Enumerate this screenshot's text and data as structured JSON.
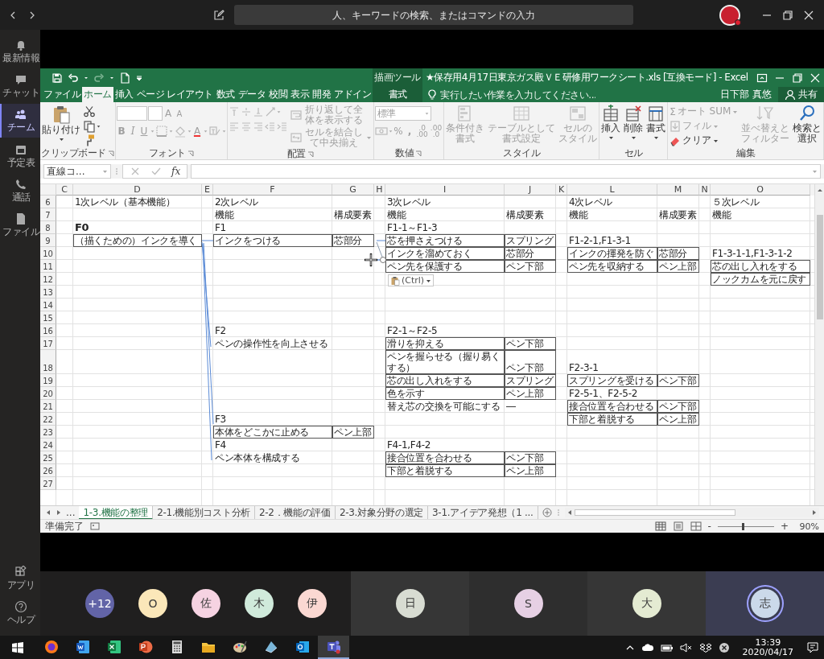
{
  "teams": {
    "search": {
      "placeholder": "人、キーワードの検索、またはコマンドの入力"
    },
    "rail": [
      {
        "label": "最新情報",
        "selected": false
      },
      {
        "label": "チャット",
        "selected": false
      },
      {
        "label": "チーム",
        "selected": true
      },
      {
        "label": "予定表",
        "selected": false
      },
      {
        "label": "通話",
        "selected": false
      },
      {
        "label": "ファイル",
        "selected": false
      }
    ],
    "rail_bottom": [
      {
        "label": "アプリ"
      },
      {
        "label": "ヘルプ"
      }
    ]
  },
  "excel": {
    "context_label": "描画ツール",
    "title": "★保存用4月17日東京ガス殿ＶＥ研修用ワークシート.xls  [互換モード] - Excel",
    "tabs": [
      {
        "label": "ファイル",
        "selected": false,
        "kind": "main"
      },
      {
        "label": "ホーム",
        "selected": true,
        "kind": "main"
      },
      {
        "label": "挿入",
        "selected": false,
        "kind": "main"
      },
      {
        "label": "ページ レイアウト",
        "selected": false,
        "kind": "main"
      },
      {
        "label": "数式",
        "selected": false,
        "kind": "main"
      },
      {
        "label": "データ",
        "selected": false,
        "kind": "main"
      },
      {
        "label": "校閲",
        "selected": false,
        "kind": "main"
      },
      {
        "label": "表示",
        "selected": false,
        "kind": "main"
      },
      {
        "label": "開発",
        "selected": false,
        "kind": "main"
      },
      {
        "label": "アドイン",
        "selected": false,
        "kind": "main"
      },
      {
        "label": "書式",
        "selected": false,
        "kind": "context"
      }
    ],
    "tell_me": {
      "placeholder": "実行したい作業を入力してください..."
    },
    "user": "日下部 真悠",
    "share": "共有",
    "ribbon": {
      "clipboard": {
        "label": "クリップボード",
        "paste": {
          "label": "貼り付け",
          "disabled": false
        }
      },
      "font": {
        "label": "フォント",
        "buttons": [
          {
            "label": "A",
            "disabled": true
          },
          {
            "label": "A",
            "disabled": true
          },
          {
            "label": "B",
            "disabled": true
          },
          {
            "label": "I",
            "disabled": true
          },
          {
            "label": "U",
            "disabled": true
          },
          {
            "label": "A",
            "disabled": true
          }
        ]
      },
      "alignment": {
        "label": "配置",
        "wrap": {
          "label": "折り返して全体を表示する",
          "disabled": true
        },
        "merge": {
          "label": "セルを結合して中央揃え",
          "disabled": true
        }
      },
      "number": {
        "label": "数値",
        "format": {
          "value": "標準",
          "disabled": true
        },
        "buttons": [
          {
            "label": "%",
            "disabled": true
          },
          {
            "label": ",",
            "disabled": true
          },
          {
            "lines": [
              ".0",
              ".00"
            ],
            "disabled": true
          },
          {
            "lines": [
              ".00",
              ".0"
            ],
            "disabled": true
          }
        ]
      },
      "styles": {
        "label": "スタイル",
        "conditional": {
          "lines": [
            "条件付き",
            "書式"
          ],
          "disabled": true
        },
        "table": {
          "lines": [
            "テーブルとして",
            "書式設定"
          ],
          "disabled": true
        },
        "cell_styles": {
          "lines": [
            "セルの",
            "スタイル"
          ],
          "disabled": true
        }
      },
      "cells": {
        "label": "セル",
        "insert": {
          "label": "挿入",
          "disabled": false
        },
        "delete": {
          "label": "削除",
          "disabled": false
        },
        "format": {
          "label": "書式",
          "disabled": false
        }
      },
      "editing": {
        "label": "編集",
        "sigma": "Σ",
        "autosum": {
          "label": "オート SUM",
          "disabled": true
        },
        "fill": {
          "label": "フィル",
          "disabled": true
        },
        "clear": {
          "label": "クリア",
          "disabled": false
        },
        "sort": {
          "lines": [
            "並べ替えと",
            "フィルター"
          ],
          "disabled": true
        },
        "find": {
          "lines": [
            "検索と",
            "選択"
          ],
          "disabled": false
        }
      }
    },
    "formula_bar": {
      "name_box": "直線コ...",
      "fx": "fx"
    },
    "sheet": {
      "columns": [
        "C",
        "D",
        "E",
        "F",
        "G",
        "H",
        "I",
        "J",
        "K",
        "L",
        "M",
        "N",
        "O"
      ],
      "rows": [
        {
          "number": "6",
          "tall": false,
          "cells": [
            null,
            {
              "text": "1次レベル（基本機能）",
              "boxed": false
            },
            null,
            {
              "text": "2次レベル",
              "boxed": false
            },
            null,
            null,
            {
              "text": "3次レベル",
              "boxed": false
            },
            null,
            null,
            {
              "text": "4次レベル",
              "boxed": false
            },
            null,
            null,
            {
              "text": "５次レベル",
              "boxed": false
            }
          ]
        },
        {
          "number": "7",
          "tall": false,
          "cells": [
            null,
            null,
            null,
            {
              "text": "機能",
              "boxed": false
            },
            {
              "text": "構成要素",
              "boxed": false
            },
            null,
            {
              "text": "機能",
              "boxed": false
            },
            {
              "text": "構成要素",
              "boxed": false
            },
            null,
            {
              "text": "機能",
              "boxed": false
            },
            {
              "text": "構成要素",
              "boxed": false
            },
            null,
            {
              "text": "機能",
              "boxed": false
            }
          ]
        },
        {
          "number": "8",
          "tall": false,
          "cells": [
            null,
            {
              "text": "F0",
              "boxed": false,
              "bold": true
            },
            null,
            {
              "text": "F1",
              "boxed": false
            },
            null,
            null,
            {
              "text": "F1-1～F1-3",
              "boxed": false
            },
            null,
            null,
            null,
            null,
            null,
            null
          ]
        },
        {
          "number": "9",
          "tall": false,
          "cells": [
            null,
            {
              "text": "（描くための）インクを導く",
              "boxed": true
            },
            null,
            {
              "text": "インクをつける",
              "boxed": true
            },
            {
              "text": "芯部分",
              "boxed": true
            },
            null,
            {
              "text": "芯を押さえつける",
              "boxed": true
            },
            {
              "text": "スプリング",
              "boxed": true
            },
            null,
            {
              "text": "F1-2-1,F1-3-1",
              "boxed": false
            },
            null,
            null,
            null
          ]
        },
        {
          "number": "10",
          "tall": false,
          "cells": [
            null,
            null,
            null,
            null,
            null,
            null,
            {
              "text": "インクを溜めておく",
              "boxed": true
            },
            {
              "text": "芯部分",
              "boxed": true
            },
            null,
            {
              "text": "インクの揮発を防ぐ",
              "boxed": true
            },
            {
              "text": "芯部分",
              "boxed": true
            },
            null,
            {
              "text": "F1-3-1-1,F1-3-1-2",
              "boxed": false
            }
          ]
        },
        {
          "number": "11",
          "tall": false,
          "cells": [
            null,
            null,
            null,
            null,
            null,
            null,
            {
              "text": "ペン先を保護する",
              "boxed": true
            },
            {
              "text": "ペン下部",
              "boxed": true
            },
            null,
            {
              "text": "ペン先を収納する",
              "boxed": true
            },
            {
              "text": "ペン上部",
              "boxed": true
            },
            null,
            {
              "text": "芯の出し入れをする",
              "boxed": true
            }
          ]
        },
        {
          "number": "12",
          "tall": false,
          "cells": [
            null,
            null,
            null,
            null,
            null,
            null,
            null,
            null,
            null,
            null,
            null,
            null,
            {
              "text": "ノックカムを元に戻す",
              "boxed": true
            }
          ]
        },
        {
          "number": "13",
          "tall": false
        },
        {
          "number": "14",
          "tall": false
        },
        {
          "number": "15",
          "tall": false
        },
        {
          "number": "16",
          "tall": false,
          "cells": [
            null,
            null,
            null,
            {
              "text": "F2",
              "boxed": false
            },
            null,
            null,
            {
              "text": "F2-1～F2-5",
              "boxed": false
            },
            null,
            null,
            null,
            null,
            null,
            null
          ]
        },
        {
          "number": "17",
          "tall": false,
          "cells": [
            null,
            null,
            null,
            {
              "text": "ペンの操作性を向上させる",
              "boxed": false
            },
            null,
            null,
            {
              "text": "滑りを抑える",
              "boxed": true
            },
            {
              "text": "ペン下部",
              "boxed": true
            },
            null,
            null,
            null,
            null,
            null
          ]
        },
        {
          "number": "18",
          "tall": true,
          "cells": [
            null,
            null,
            null,
            null,
            null,
            null,
            {
              "text": "ペンを握らせる（握り易くする）",
              "boxed": true
            },
            {
              "text": "ペン下部",
              "boxed": true
            },
            null,
            {
              "text": "F2-3-1",
              "boxed": false
            },
            null,
            null,
            null
          ]
        },
        {
          "number": "19",
          "tall": false,
          "cells": [
            null,
            null,
            null,
            null,
            null,
            null,
            {
              "text": "芯の出し入れをする",
              "boxed": true
            },
            {
              "text": "スプリング",
              "boxed": true
            },
            null,
            {
              "text": "スプリングを受ける",
              "boxed": true
            },
            {
              "text": "ペン下部",
              "boxed": true
            },
            null,
            null
          ]
        },
        {
          "number": "20",
          "tall": false,
          "cells": [
            null,
            null,
            null,
            null,
            null,
            null,
            {
              "text": "色を示す",
              "boxed": true
            },
            {
              "text": "ペン上部",
              "boxed": true
            },
            null,
            {
              "text": "F2-5-1、F2-5-2",
              "boxed": false
            },
            null,
            null,
            null
          ]
        },
        {
          "number": "21",
          "tall": false,
          "cells": [
            null,
            null,
            null,
            null,
            null,
            null,
            {
              "text": "替え芯の交換を可能にする",
              "boxed": false
            },
            {
              "text": "―",
              "boxed": false
            },
            null,
            {
              "text": "接合位置を合わせる",
              "boxed": true
            },
            {
              "text": "ペン下部",
              "boxed": true
            },
            null,
            null
          ]
        },
        {
          "number": "22",
          "tall": false,
          "cells": [
            null,
            null,
            null,
            {
              "text": "F3",
              "boxed": false
            },
            null,
            null,
            null,
            null,
            null,
            {
              "text": "下部と着脱する",
              "boxed": true
            },
            {
              "text": "ペン上部",
              "boxed": true
            },
            null,
            null
          ]
        },
        {
          "number": "23",
          "tall": false,
          "cells": [
            null,
            null,
            null,
            {
              "text": "本体をどこかに止める",
              "boxed": true
            },
            {
              "text": "ペン上部",
              "boxed": true
            },
            null,
            null,
            null,
            null,
            null,
            null,
            null,
            null
          ]
        },
        {
          "number": "24",
          "tall": false,
          "cells": [
            null,
            null,
            null,
            {
              "text": "F4",
              "boxed": false
            },
            null,
            null,
            {
              "text": "F4-1,F4-2",
              "boxed": false
            },
            null,
            null,
            null,
            null,
            null,
            null
          ]
        },
        {
          "number": "25",
          "tall": false,
          "cells": [
            null,
            null,
            null,
            {
              "text": "ペン本体を構成する",
              "boxed": false
            },
            null,
            null,
            {
              "text": "接合位置を合わせる",
              "boxed": true
            },
            {
              "text": "ペン下部",
              "boxed": true
            },
            null,
            null,
            null,
            null,
            null
          ]
        },
        {
          "number": "26",
          "tall": false,
          "cells": [
            null,
            null,
            null,
            null,
            null,
            null,
            {
              "text": "下部と着脱する",
              "boxed": true
            },
            {
              "text": "ペン上部",
              "boxed": true
            },
            null,
            null,
            null,
            null,
            null
          ]
        },
        {
          "number": "27",
          "tall": false
        }
      ]
    },
    "paste_options": "(Ctrl)",
    "tab_overflow": "...",
    "sheet_tabs": [
      {
        "label": "1-3.機能の整理",
        "selected": true
      },
      {
        "label": "2-1.機能別コスト分析",
        "selected": false
      },
      {
        "label": "2-2．機能の評価",
        "selected": false
      },
      {
        "label": "2-3.対象分野の選定",
        "selected": false
      },
      {
        "label": "3-1.アイデア発想（1 ...",
        "selected": false
      }
    ],
    "status_bar": {
      "ready": "準備完了",
      "zoom_out": "-",
      "zoom_in": "+",
      "zoom": {
        "level": 0.45,
        "reading": "90%"
      }
    }
  },
  "participants": {
    "roster": [
      {
        "initials": "+12",
        "color": "#6264a7"
      },
      {
        "initials": "O",
        "color": "#fbe7b9"
      },
      {
        "initials": "佐",
        "color": "#f6d3e2"
      },
      {
        "initials": "木",
        "color": "#d0eadb"
      },
      {
        "initials": "伊",
        "color": "#fbd8d2"
      }
    ],
    "tiles": [
      {
        "initials": "日",
        "color": "#d8dcd2",
        "speaking": false
      },
      {
        "initials": "S",
        "color": "#e6d0e4",
        "speaking": false
      },
      {
        "initials": "大",
        "color": "#e4ebd2",
        "speaking": false
      },
      {
        "initials": "志",
        "color": "#cbd9ea",
        "speaking": true
      }
    ]
  },
  "taskbar": {
    "apps": [
      {
        "selected": false
      },
      {
        "selected": false
      },
      {
        "selected": false
      },
      {
        "selected": false
      },
      {
        "selected": false
      },
      {
        "selected": false
      },
      {
        "selected": false
      },
      {
        "selected": false
      },
      {
        "selected": false
      },
      {
        "selected": true
      }
    ],
    "time": "13:39",
    "date": "2020/04/17"
  }
}
